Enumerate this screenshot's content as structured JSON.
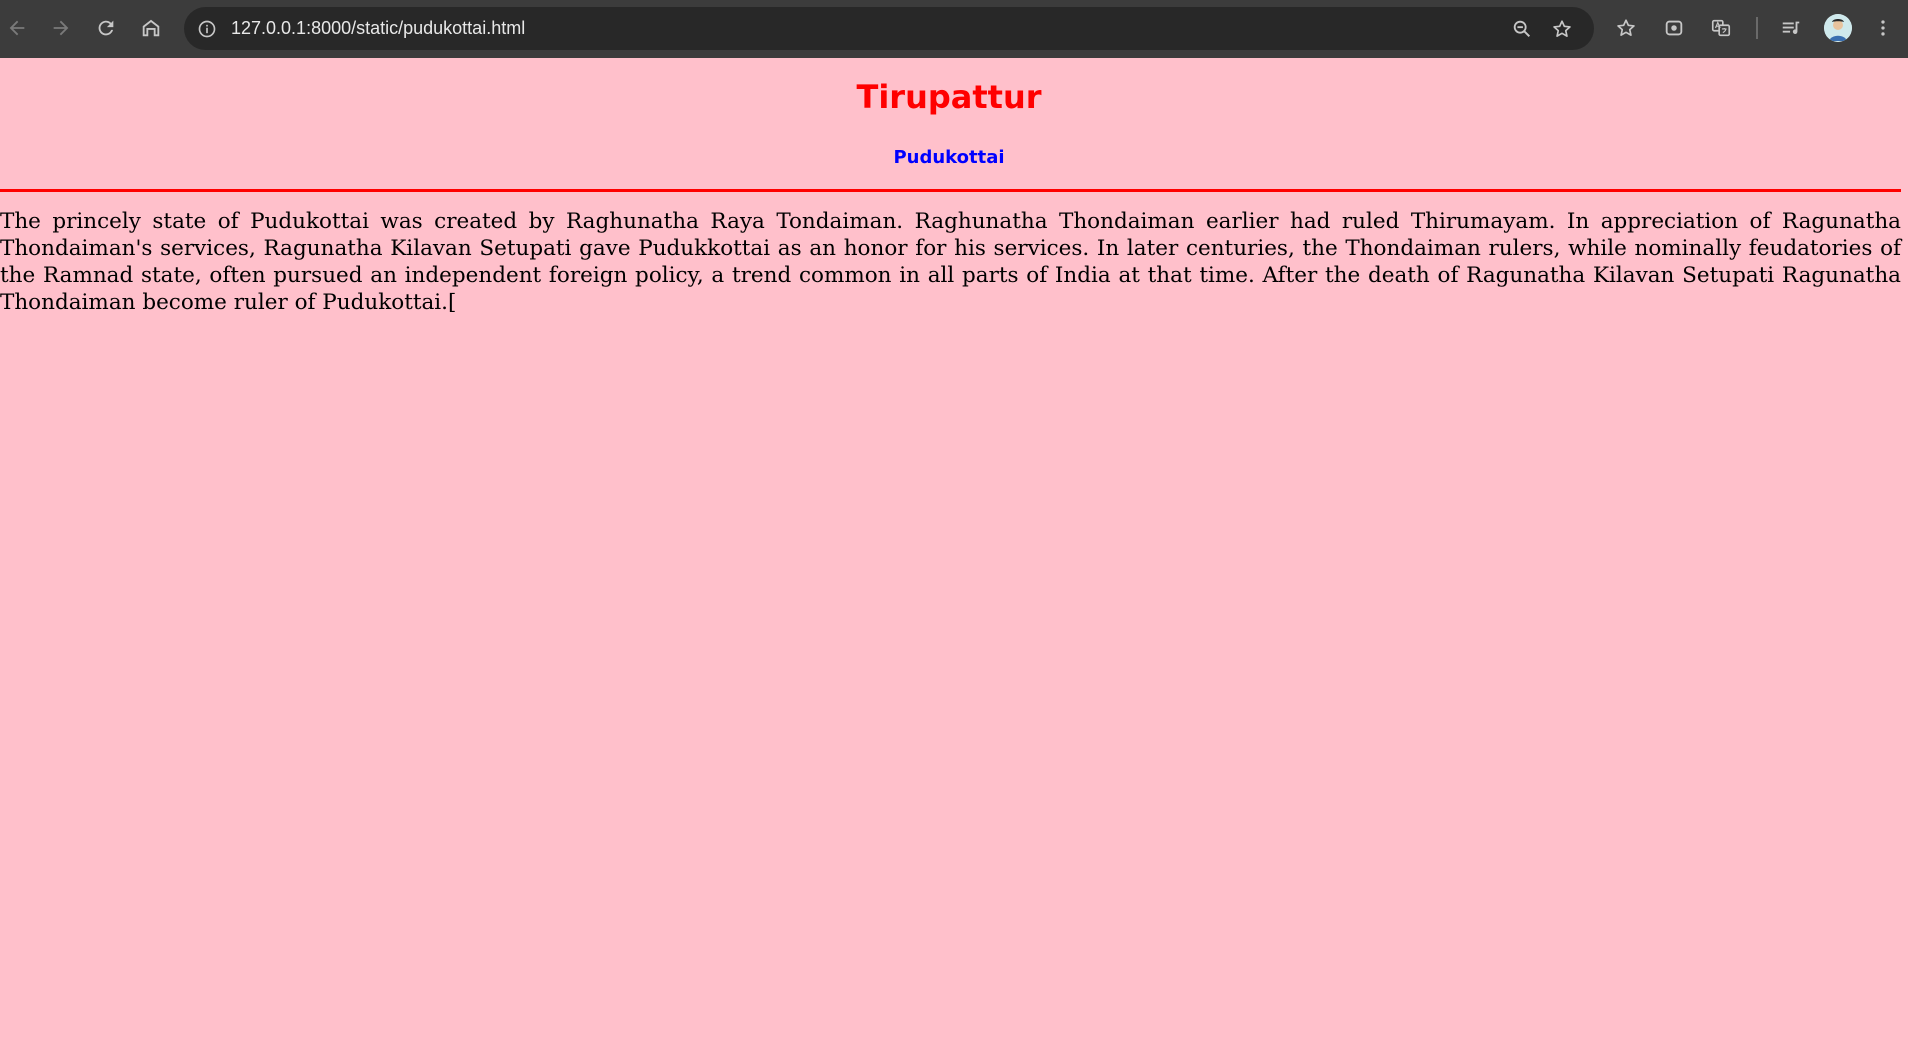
{
  "browser": {
    "url": "127.0.0.1:8000/static/pudukottai.html",
    "icons": {
      "back": "back-arrow-icon",
      "forward": "forward-arrow-icon",
      "reload": "reload-icon",
      "home": "home-icon",
      "site_info": "info-icon",
      "zoom": "zoom-icon",
      "bookmark": "star-icon",
      "bookmarks_menu": "bookmark-star-icon",
      "lens": "lens-icon",
      "translate": "translate-icon",
      "media": "media-queue-icon",
      "profile": "profile-avatar",
      "menu": "kebab-menu-icon"
    },
    "colors": {
      "toolbar": "#3c3c3c",
      "omnibox": "#282828",
      "icon": "#c7c7c7"
    }
  },
  "page": {
    "title": "Tirupattur",
    "subtitle": "Pudukottai",
    "paragraph": "The princely state of Pudukottai was created by Raghunatha Raya Tondaiman. Raghunatha Thondaiman earlier had ruled Thirumayam. In appreciation of Ragunatha Thondaiman's services, Ragunatha Kilavan Setupati gave Pudukkottai as an honor for his services. In later centuries, the Thondaiman rulers, while nominally feudatories of the Ramnad state, often pursued an independent foreign policy, a trend common in all parts of India at that time. After the death of Ragunatha Kilavan Setupati Ragunatha Thondaiman become ruler of Pudukottai.[",
    "colors": {
      "background": "#ffc0cb",
      "title": "#ff0000",
      "subtitle": "#0000ff",
      "rule": "#ff0000",
      "text": "#000000"
    }
  }
}
